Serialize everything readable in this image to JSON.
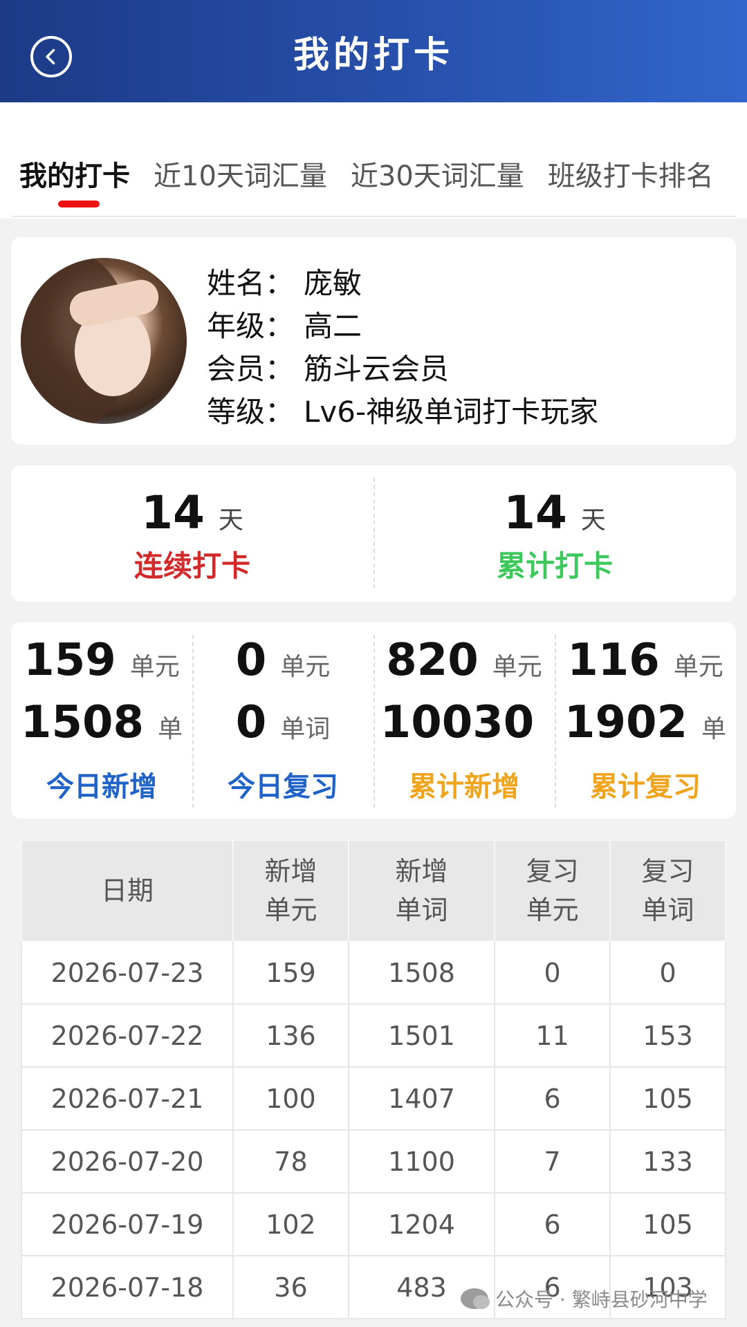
{
  "header": {
    "title": "我的打卡"
  },
  "tabs": [
    {
      "label": "我的打卡"
    },
    {
      "label": "近10天词汇量"
    },
    {
      "label": "近30天词汇量"
    },
    {
      "label": "班级打卡排名"
    }
  ],
  "profile": {
    "rows": [
      {
        "key": "姓名：",
        "value": "庞敏"
      },
      {
        "key": "年级：",
        "value": "高二"
      },
      {
        "key": "会员：",
        "value": "筋斗云会员"
      },
      {
        "key": "等级：",
        "value": "Lv6-神级单词打卡玩家"
      }
    ]
  },
  "checkin": {
    "left": {
      "value": "14",
      "unit": "天",
      "label": "连续打卡",
      "color": "#d22a2a"
    },
    "right": {
      "value": "14",
      "unit": "天",
      "label": "累计打卡",
      "color": "#3cc85a"
    }
  },
  "stats": [
    {
      "v1": "159",
      "u1": "单元",
      "v2": "1508",
      "u2": "单",
      "label": "今日新增",
      "color": "#1f62c8"
    },
    {
      "v1": "0",
      "u1": "单元",
      "v2": "0",
      "u2": "单词",
      "label": "今日复习",
      "color": "#1f62c8"
    },
    {
      "v1": "820",
      "u1": "单元",
      "v2": "10030",
      "u2": "",
      "label": "累计新增",
      "color": "#f0a41c"
    },
    {
      "v1": "116",
      "u1": "单元",
      "v2": "1902",
      "u2": "单",
      "label": "累计复习",
      "color": "#f0a41c"
    }
  ],
  "table": {
    "headers": [
      "日期",
      "新增\n单元",
      "新增\n单词",
      "复习\n单元",
      "复习\n单词"
    ],
    "rows": [
      [
        "2026-07-23",
        "159",
        "1508",
        "0",
        "0"
      ],
      [
        "2026-07-22",
        "136",
        "1501",
        "11",
        "153"
      ],
      [
        "2026-07-21",
        "100",
        "1407",
        "6",
        "105"
      ],
      [
        "2026-07-20",
        "78",
        "1100",
        "7",
        "133"
      ],
      [
        "2026-07-19",
        "102",
        "1204",
        "6",
        "105"
      ],
      [
        "2026-07-18",
        "36",
        "483",
        "6",
        "103"
      ]
    ]
  },
  "watermark": {
    "text": "公众号 · 繁峙县砂河中学"
  }
}
